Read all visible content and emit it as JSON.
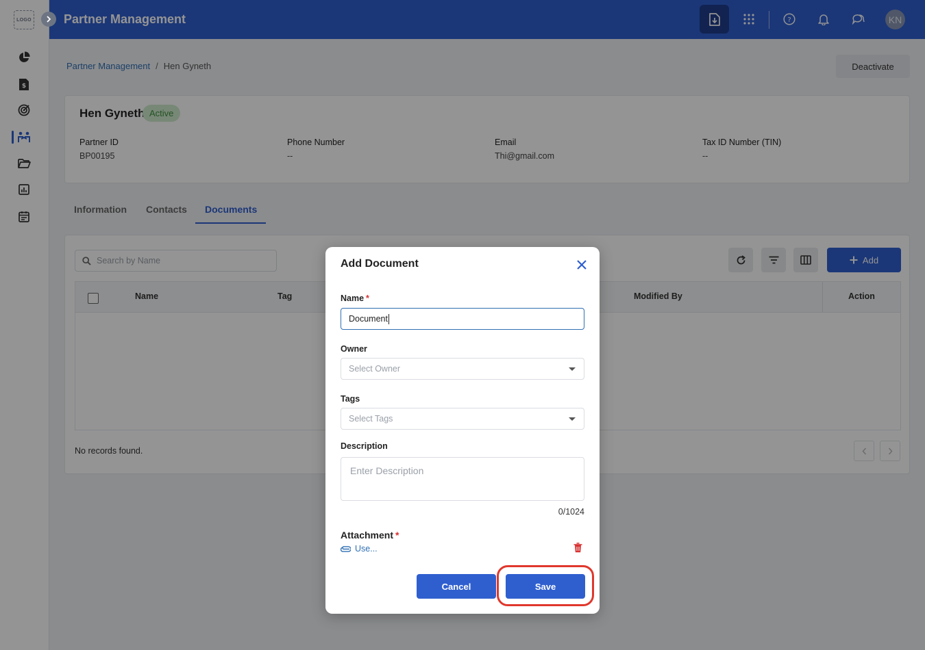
{
  "sidebar": {
    "logo_text": "LOGO",
    "items": [
      {
        "icon": "pie-chart-icon"
      },
      {
        "icon": "invoice-icon"
      },
      {
        "icon": "target-icon"
      },
      {
        "icon": "partners-icon",
        "active": true
      },
      {
        "icon": "folder-icon"
      },
      {
        "icon": "report-icon"
      },
      {
        "icon": "calendar-icon"
      }
    ]
  },
  "header": {
    "title": "Partner Management",
    "avatar_initials": "KN",
    "icons": [
      "download-document-icon",
      "apps-grid-icon",
      "help-icon",
      "bell-icon",
      "chat-icon"
    ]
  },
  "breadcrumb": {
    "parent": "Partner Management",
    "separator": "/",
    "current": "Hen Gyneth"
  },
  "actions": {
    "deactivate_label": "Deactivate"
  },
  "partner": {
    "name": "Hen Gyneth",
    "status": "Active",
    "fields": [
      {
        "label": "Partner ID",
        "value": "BP00195"
      },
      {
        "label": "Phone Number",
        "value": "--"
      },
      {
        "label": "Email",
        "value": "Thi@gmail.com"
      },
      {
        "label": "Tax ID Number (TIN)",
        "value": "--"
      }
    ]
  },
  "tabs": [
    {
      "label": "Information"
    },
    {
      "label": "Contacts"
    },
    {
      "label": "Documents",
      "active": true
    }
  ],
  "documents": {
    "search_placeholder": "Search by Name",
    "add_label": "Add",
    "columns": [
      "Name",
      "Tag",
      "Modified By",
      "Action"
    ],
    "empty_text": "No records found."
  },
  "modal": {
    "title": "Add Document",
    "name_label": "Name",
    "name_value": "Document",
    "owner_label": "Owner",
    "owner_placeholder": "Select Owner",
    "tags_label": "Tags",
    "tags_placeholder": "Select Tags",
    "description_label": "Description",
    "description_placeholder": "Enter Description",
    "char_count": "0/1024",
    "attachment_label": "Attachment",
    "attachment_file": "Use...",
    "required_mark": "*",
    "cancel_label": "Cancel",
    "save_label": "Save"
  },
  "colors": {
    "primary": "#2f5fcf",
    "header_active": "#1f3d8c",
    "success_bg": "#cfeacd",
    "success_text": "#3f8f3d",
    "required": "#d93232",
    "highlight": "#e0372c"
  }
}
